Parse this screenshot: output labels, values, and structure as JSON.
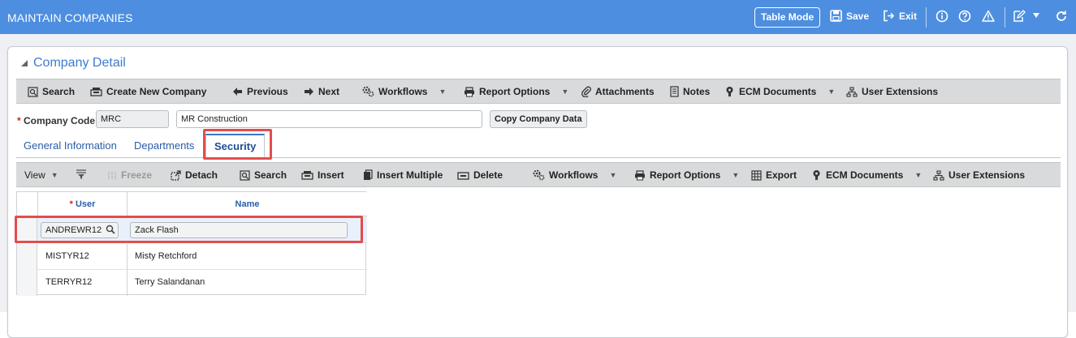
{
  "header": {
    "title": "MAINTAIN COMPANIES",
    "table_mode": "Table Mode",
    "save": "Save",
    "exit": "Exit"
  },
  "panel": {
    "title": "Company Detail"
  },
  "toolbar": {
    "search": "Search",
    "create": "Create New Company",
    "previous": "Previous",
    "next": "Next",
    "workflows": "Workflows",
    "report_options": "Report Options",
    "attachments": "Attachments",
    "notes": "Notes",
    "ecm": "ECM Documents",
    "user_ext": "User Extensions"
  },
  "form": {
    "company_code_label": "Company Code",
    "required_mark": "*",
    "company_code": "MRC",
    "company_name": "MR Construction",
    "copy_button": "Copy Company Data"
  },
  "tabs": [
    "General Information",
    "Departments",
    "Security"
  ],
  "sub_toolbar": {
    "view": "View",
    "freeze": "Freeze",
    "detach": "Detach",
    "search": "Search",
    "insert": "Insert",
    "insert_multiple": "Insert Multiple",
    "delete": "Delete",
    "workflows": "Workflows",
    "report_options": "Report Options",
    "export": "Export",
    "ecm": "ECM Documents",
    "user_ext": "User Extensions"
  },
  "grid": {
    "columns": [
      "User",
      "Name"
    ],
    "rows": [
      {
        "user": "ANDREWR12",
        "name": "Zack Flash"
      },
      {
        "user": "MISTYR12",
        "name": "Misty Retchford"
      },
      {
        "user": "TERRYR12",
        "name": "Terry Salandanan"
      }
    ]
  },
  "colors": {
    "title_bar": "#4d8ee0",
    "accent": "#3c7ccf",
    "highlight": "#e44c4c"
  }
}
